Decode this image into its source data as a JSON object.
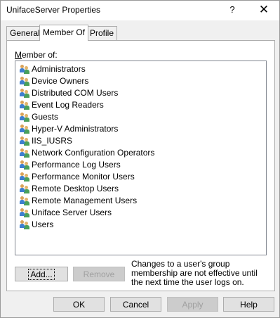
{
  "window": {
    "title": "UnifaceServer Properties",
    "help_glyph": "?",
    "close_glyph": "✕"
  },
  "tabs": [
    {
      "label": "General"
    },
    {
      "label": "Member Of",
      "active": true
    },
    {
      "label": "Profile"
    }
  ],
  "member_of": {
    "label": "Member of:",
    "groups": [
      "Administrators",
      "Device Owners",
      "Distributed COM Users",
      "Event Log Readers",
      "Guests",
      "Hyper-V Administrators",
      "IIS_IUSRS",
      "Network Configuration Operators",
      "Performance Log Users",
      "Performance Monitor Users",
      "Remote Desktop Users",
      "Remote Management Users",
      "Uniface Server Users",
      "Users"
    ]
  },
  "panel_buttons": {
    "add": "Add...",
    "remove": "Remove"
  },
  "note": "Changes to a user's group membership are not effective until the next time the user logs on.",
  "dialog_buttons": {
    "ok": "OK",
    "cancel": "Cancel",
    "apply": "Apply",
    "help": "Help"
  }
}
